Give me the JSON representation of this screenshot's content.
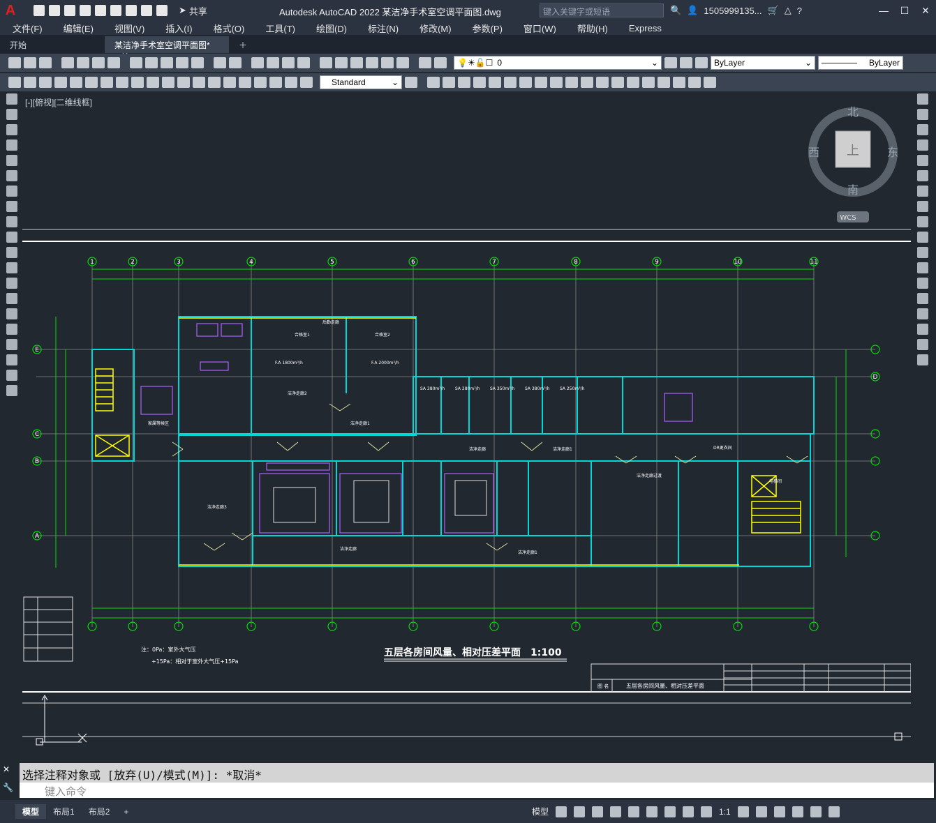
{
  "app": {
    "logo": "A",
    "title": "Autodesk AutoCAD 2022    某洁净手术室空调平面图.dwg",
    "search_placeholder": "键入关键字或短语",
    "user": "1505999135...",
    "share_label": "共享"
  },
  "menu": [
    "文件(F)",
    "编辑(E)",
    "视图(V)",
    "插入(I)",
    "格式(O)",
    "工具(T)",
    "绘图(D)",
    "标注(N)",
    "修改(M)",
    "参数(P)",
    "窗口(W)",
    "帮助(H)",
    "Express"
  ],
  "tabs": [
    {
      "label": "开始"
    },
    {
      "label": "某洁净手术室空调平面图*"
    }
  ],
  "toolbar": {
    "layer_value": "0",
    "color_value": "ByLayer",
    "linetype_value": "ByLayer",
    "textstyle_value": "Standard"
  },
  "canvas": {
    "view_label": "[-][俯视][二维线框]",
    "viewcube": {
      "north": "北",
      "south": "南",
      "east": "东",
      "west": "西",
      "top": "上",
      "wcs": "WCS"
    },
    "drawing_title": "五层各房间风量、相对压差平面　1:100",
    "note_line1": "注：0Pa：室外大气压",
    "note_line2": "+15Pa：相对于室外大气压+15Pa",
    "titleblock_name_label": "图 名",
    "titleblock_name": "五层各房间风量、相对压差平面",
    "grid_top": [
      "1",
      "2",
      "3",
      "4",
      "5",
      "6",
      "7",
      "8",
      "9",
      "10",
      "11"
    ],
    "grid_side": [
      "E",
      "D",
      "C",
      "B",
      "A"
    ]
  },
  "command": {
    "history": "选择注释对象或 [放弃(U)/模式(M)]: *取消*",
    "placeholder": "键入命令"
  },
  "status": {
    "layout_tabs": [
      "模型",
      "布局1",
      "布局2"
    ],
    "model_label": "模型",
    "scale_label": "1:1"
  }
}
